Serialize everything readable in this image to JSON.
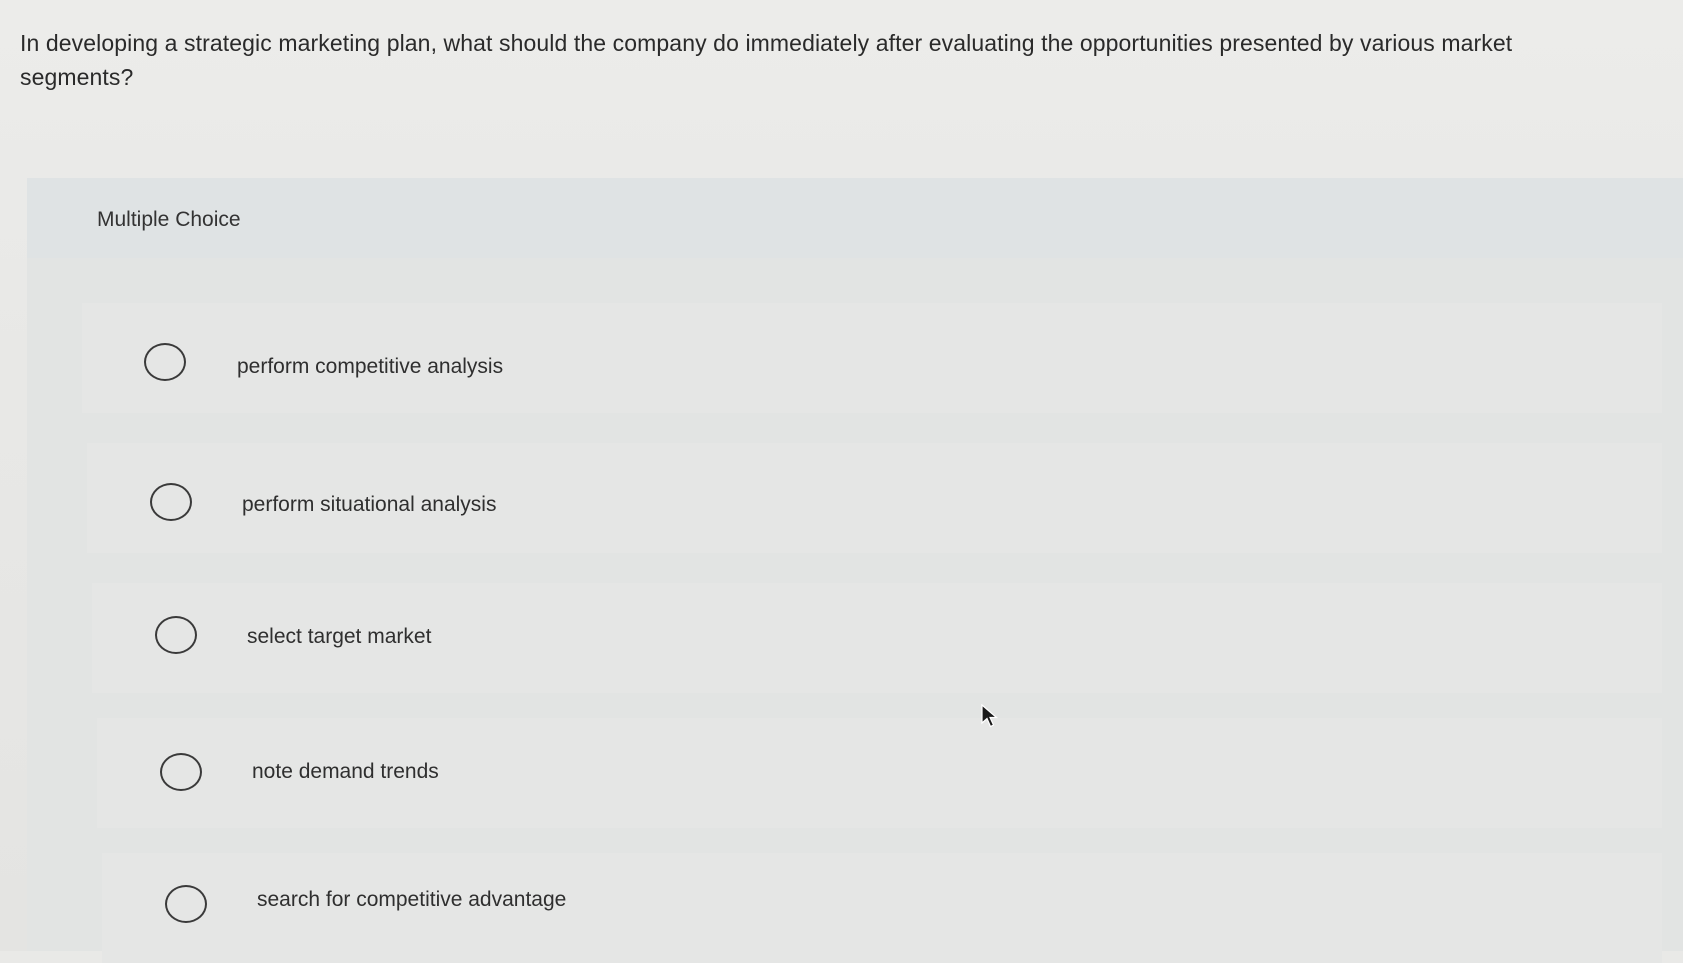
{
  "question": {
    "text": "In developing a strategic marketing plan, what should the company do immediately after evaluating the opportunities presented by various market segments?"
  },
  "choices": {
    "heading": "Multiple Choice",
    "options": [
      {
        "label": "perform competitive analysis",
        "selected": false
      },
      {
        "label": "perform situational analysis",
        "selected": false
      },
      {
        "label": "select target market",
        "selected": false
      },
      {
        "label": "note demand trends",
        "selected": false
      },
      {
        "label": "search for competitive advantage",
        "selected": false
      }
    ]
  },
  "cursor": {
    "icon": "mouse-pointer-icon"
  }
}
